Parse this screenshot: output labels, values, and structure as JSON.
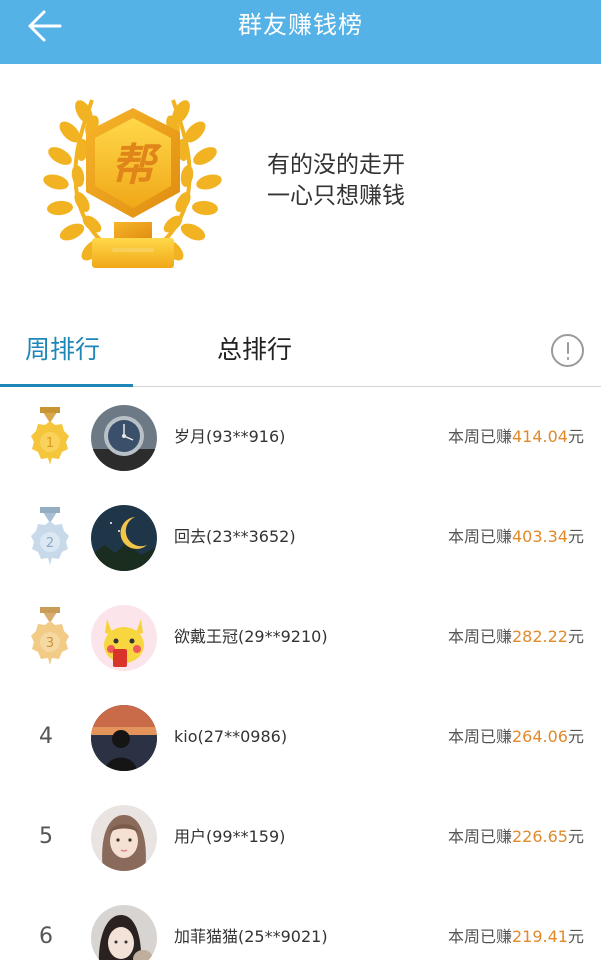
{
  "header": {
    "title": "群友赚钱榜",
    "back_icon": "arrow-left-icon",
    "bg_color": "#55b2e6"
  },
  "hero": {
    "trophy_glyph": "帮",
    "slogan_line1": "有的没的走开",
    "slogan_line2": "一心只想赚钱"
  },
  "tabs": {
    "weekly": "周排行",
    "total": "总排行",
    "active": "周排行",
    "accent_color": "#1e86b8",
    "info_icon": "info-circle-icon"
  },
  "leaderboard": [
    {
      "rank": "1",
      "medal": "gold",
      "name": "岁月(93**916)",
      "earn_prefix": "本周已赚",
      "amount": "414.04",
      "unit": "元"
    },
    {
      "rank": "2",
      "medal": "silver",
      "name": "回去(23**3652)",
      "earn_prefix": "本周已赚",
      "amount": "403.34",
      "unit": "元"
    },
    {
      "rank": "3",
      "medal": "bronze",
      "name": "欲戴王冠(29**9210)",
      "earn_prefix": "本周已赚",
      "amount": "282.22",
      "unit": "元"
    },
    {
      "rank": "4",
      "medal": "",
      "name": "kio(27**0986)",
      "earn_prefix": "本周已赚",
      "amount": "264.06",
      "unit": "元"
    },
    {
      "rank": "5",
      "medal": "",
      "name": "用户(99**159)",
      "earn_prefix": "本周已赚",
      "amount": "226.65",
      "unit": "元"
    },
    {
      "rank": "6",
      "medal": "",
      "name": "加菲猫猫(25**9021)",
      "earn_prefix": "本周已赚",
      "amount": "219.41",
      "unit": "元"
    }
  ],
  "colors": {
    "amount": "#e08a2c",
    "gold_medal": "#f2c23a",
    "silver_medal": "#bcd3e6",
    "bronze_medal": "#f0c878"
  }
}
